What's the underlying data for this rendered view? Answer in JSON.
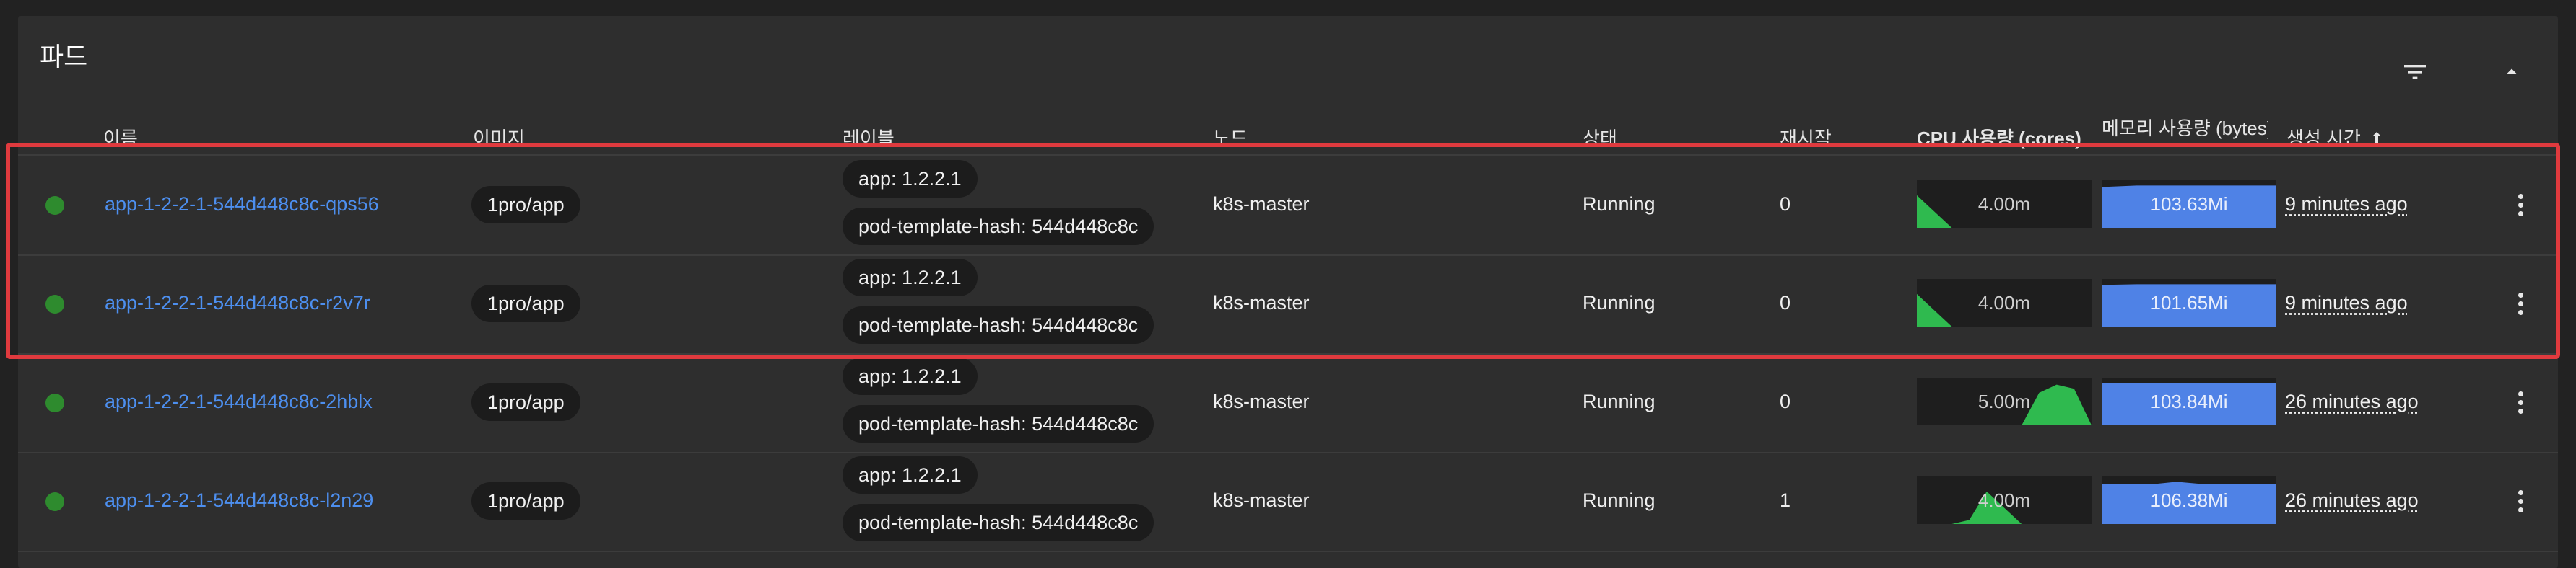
{
  "section": {
    "title": "파드"
  },
  "columns": {
    "name": "이름",
    "image": "이미지",
    "labels": "레이블",
    "node": "노드",
    "status": "상태",
    "restarts": "재시작",
    "cpu": "CPU 사용량 (cores)",
    "memory": "메모리 사용량 (bytes)",
    "created": "생성 시간",
    "sort_icon": "arrow-up-icon"
  },
  "icons": {
    "filter": "filter-icon",
    "collapse": "chevron-up-icon",
    "more": "more-vert-icon"
  },
  "colors": {
    "status_running": "#2e8b2e",
    "link": "#4d8fef",
    "cpu_fill": "#2fba4f",
    "memory_fill": "#4f82e6",
    "highlight": "#e03a3e"
  },
  "pods": [
    {
      "name": "app-1-2-2-1-544d448c8c-qps56",
      "image": "1pro/app",
      "labels": [
        "app: 1.2.2.1",
        "pod-template-hash: 544d448c8c"
      ],
      "node": "k8s-master",
      "status": "Running",
      "restarts": "0",
      "cpu": "4.00m",
      "memory": "103.63Mi",
      "created": "9 minutes ago",
      "cpu_series": [
        4.0,
        0.0,
        0.0,
        0.0,
        0.0,
        0.0
      ],
      "memory_series": [
        100.0,
        103.6,
        103.6,
        103.6,
        103.6,
        103.6
      ]
    },
    {
      "name": "app-1-2-2-1-544d448c8c-r2v7r",
      "image": "1pro/app",
      "labels": [
        "app: 1.2.2.1",
        "pod-template-hash: 544d448c8c"
      ],
      "node": "k8s-master",
      "status": "Running",
      "restarts": "0",
      "cpu": "4.00m",
      "memory": "101.65Mi",
      "created": "9 minutes ago",
      "cpu_series": [
        4.0,
        0.0,
        0.0,
        0.0,
        0.0,
        0.0
      ],
      "memory_series": [
        100.0,
        101.6,
        101.6,
        101.6,
        101.6,
        101.6
      ]
    },
    {
      "name": "app-1-2-2-1-544d448c8c-2hblx",
      "image": "1pro/app",
      "labels": [
        "app: 1.2.2.1",
        "pod-template-hash: 544d448c8c"
      ],
      "node": "k8s-master",
      "status": "Running",
      "restarts": "0",
      "cpu": "5.00m",
      "memory": "103.84Mi",
      "created": "26 minutes ago",
      "cpu_series": [
        0.0,
        0.0,
        0.0,
        0.0,
        0.0,
        0.0,
        0.0,
        4.0,
        5.0,
        4.5,
        0.0
      ],
      "memory_series": [
        103.8,
        103.8,
        103.8,
        103.8,
        103.8,
        103.8
      ]
    },
    {
      "name": "app-1-2-2-1-544d448c8c-l2n29",
      "image": "1pro/app",
      "labels": [
        "app: 1.2.2.1",
        "pod-template-hash: 544d448c8c"
      ],
      "node": "k8s-master",
      "status": "Running",
      "restarts": "1",
      "cpu": "4.00m",
      "memory": "106.38Mi",
      "created": "26 minutes ago",
      "cpu_series": [
        0.0,
        0.0,
        0.0,
        0.5,
        4.0,
        2.0,
        0.0,
        0.0,
        0.0,
        0.0,
        0.0
      ],
      "memory_series": [
        100.0,
        100.0,
        100.0,
        106.4,
        101.0,
        101.0,
        101.0,
        101.0
      ]
    }
  ]
}
